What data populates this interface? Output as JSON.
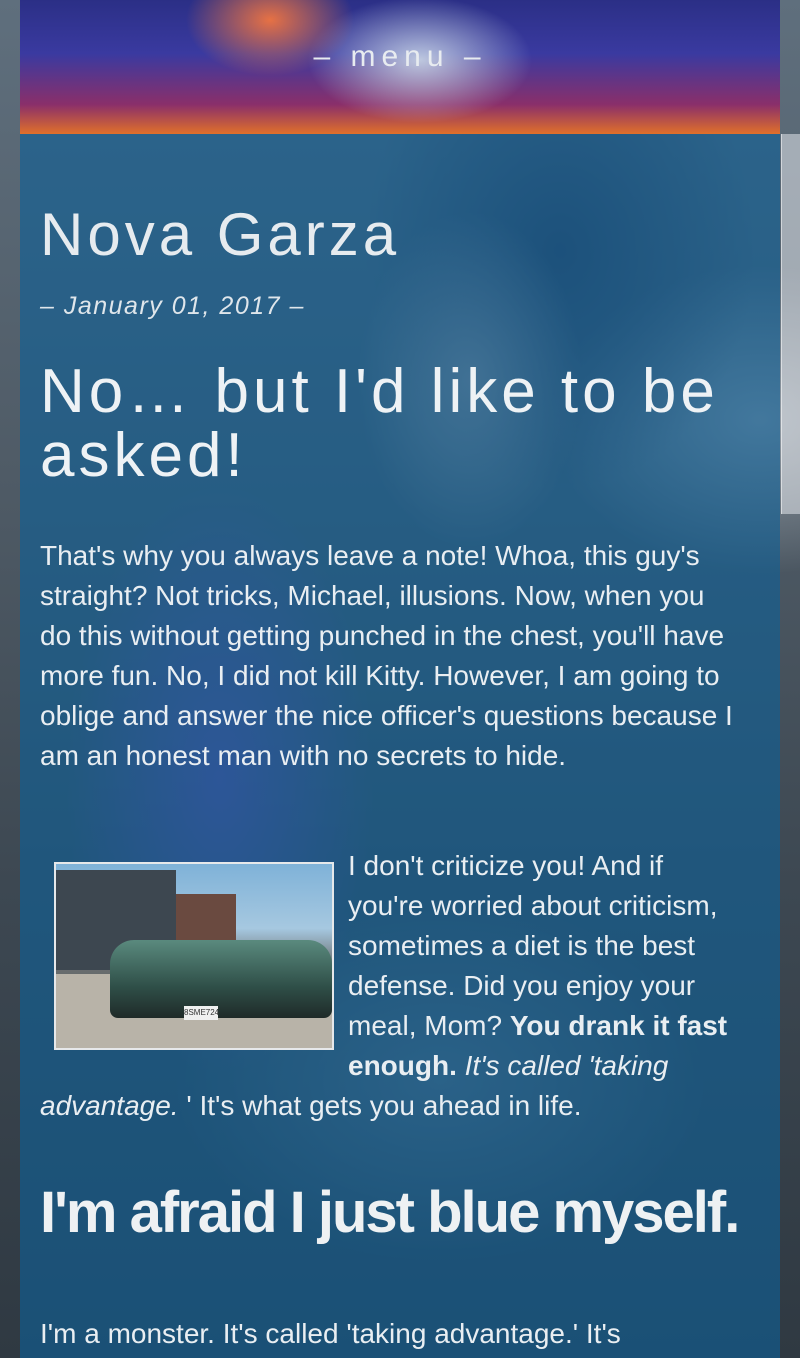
{
  "nav": {
    "menu_label": "– menu –"
  },
  "post": {
    "author": "Nova Garza",
    "date": "– January 01, 2017 –",
    "title": "No… but I'd like to be asked!",
    "paragraph1": "That's why you always leave a note! Whoa, this guy's straight? Not tricks, Michael, illusions. Now, when you do this without getting punched in the chest, you'll have more fun. No, I did not kill Kitty. However, I am going to oblige and answer the nice officer's questions because I am an honest man with no secrets to hide.",
    "paragraph2": {
      "text_start": "I don't criticize you! And if you're worried about criticism, sometimes a diet is the best defense. Did you enjoy your meal, Mom? ",
      "bold": "You drank it fast enough.",
      "italic": " It's called 'taking advantage.",
      "text_end": " ' It's what gets you ahead in life."
    },
    "image": {
      "plate_text": "8SME724"
    },
    "subheading": "I'm afraid I just blue myself.",
    "paragraph3": "I'm a monster. It's called 'taking advantage.' It's"
  }
}
